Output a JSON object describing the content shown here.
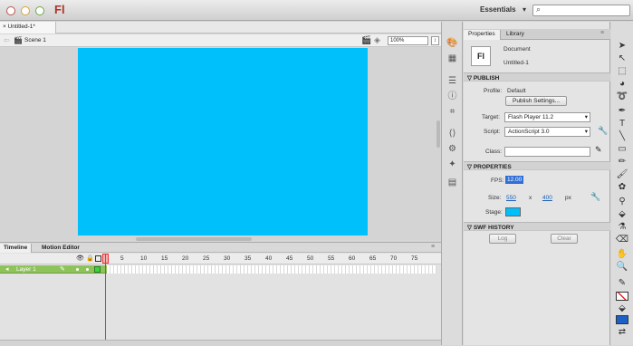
{
  "app": {
    "logo": "Fl",
    "workspace": "Essentials",
    "workspace_caret": "▾"
  },
  "doc": {
    "tab_label": "× Untitled-1*",
    "scene": "Scene 1",
    "zoom": "100%"
  },
  "stage": {
    "color": "#00c0fc"
  },
  "timeline": {
    "tabs": [
      "Timeline",
      "Motion Editor"
    ],
    "frame_numbers": [
      "1",
      "5",
      "10",
      "15",
      "20",
      "25",
      "30",
      "35",
      "40",
      "45",
      "50",
      "55",
      "60",
      "65",
      "70",
      "75"
    ],
    "layer_name": "Layer 1"
  },
  "properties": {
    "tabs": [
      "Properties",
      "Library"
    ],
    "doc_icon": "Fl",
    "doc_type": "Document",
    "doc_name": "Untitled-1",
    "publish": {
      "header": "PUBLISH",
      "profile_label": "Profile:",
      "profile_value": "Default",
      "settings_button": "Publish Settings...",
      "target_label": "Target:",
      "target_value": "Flash Player 11.2",
      "script_label": "Script:",
      "script_value": "ActionScript 3.0",
      "class_label": "Class:"
    },
    "props": {
      "header": "PROPERTIES",
      "fps_label": "FPS:",
      "fps_value": "12.00",
      "size_label": "Size:",
      "width": "550",
      "times": "x",
      "height": "400",
      "unit": "px",
      "stage_label": "Stage:"
    },
    "swf": {
      "header": "SWF HISTORY",
      "log_button": "Log",
      "clear_button": "Clear"
    }
  }
}
